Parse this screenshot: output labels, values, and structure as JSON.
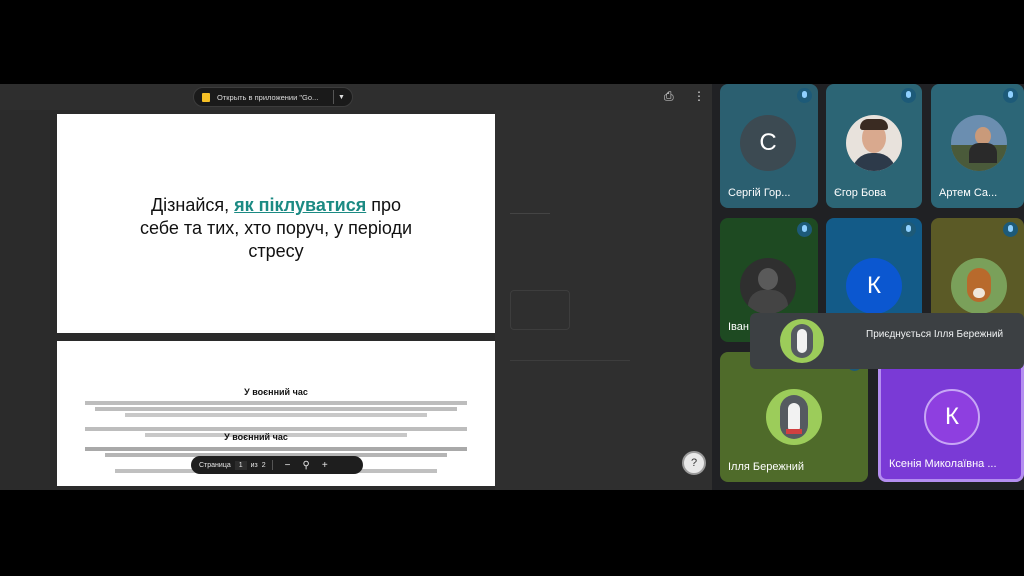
{
  "viewer": {
    "open_in_app_label": "Открыть в приложении \"Go...",
    "page1": {
      "line1_before": "Дізнайся,",
      "line1_link": "як піклуватися",
      "line1_after": "про",
      "line2": "себе та тих, хто поруч, у періоди",
      "line3": "стресу"
    },
    "page2": {
      "heading": "У воєнний час",
      "heading_repeat": "У воєнний час"
    },
    "page_bar": {
      "label": "Страница",
      "current": "1",
      "of": "из",
      "total": "2"
    }
  },
  "participants": [
    {
      "name": "Сергій Гор...",
      "initial": "С",
      "avatar_color": "#3c4a52"
    },
    {
      "name": "Єгор Бова"
    },
    {
      "name": "Артем Са..."
    },
    {
      "name": "Іван..."
    },
    {
      "name": "",
      "initial": "К",
      "avatar_color": "#0b57d0"
    },
    {
      "name": ""
    },
    {
      "name": "Ілля Бережний"
    },
    {
      "name": "Ксенія Миколаївна ...",
      "initial": "К",
      "avatar_color": "#8e3fe0"
    }
  ],
  "toast": {
    "text": "Приєднується Ілля Бережний"
  },
  "colors": {
    "link": "#1b8a83",
    "tile_teal": "#2f6f80",
    "tile_purple": "#7a3ad6"
  }
}
